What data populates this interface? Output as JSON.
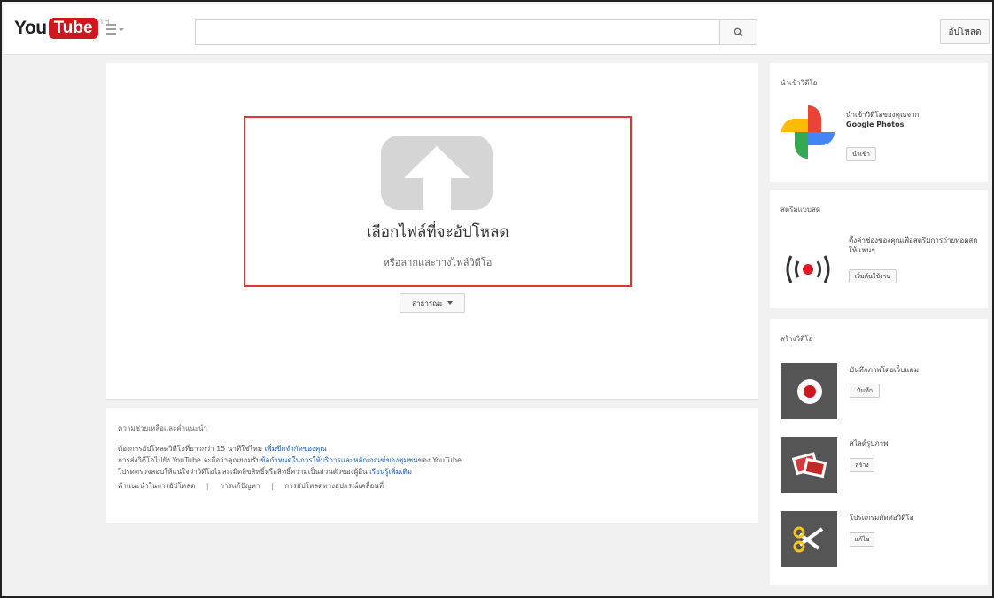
{
  "header": {
    "logo_you": "You",
    "logo_tube": "Tube",
    "logo_tm": "TH",
    "search_placeholder": "",
    "upload_label": "อัปโหลด"
  },
  "upload": {
    "title": "เลือกไฟล์ที่จะอัปโหลด",
    "subtitle": "หรือลากและวางไฟล์วิดีโอ",
    "privacy_selected": "สาธารณะ"
  },
  "help": {
    "title": "ความช่วยเหลือและคำแนะนำ",
    "line1": "ต้องการอัปโหลดวิดีโอที่ยาวกว่า 15 นาทีใช่ไหม ",
    "line1_link": "เพิ่มขีดจำกัดของคุณ",
    "line2_pre": "การส่งวิดีโอไปยัง YouTube จะถือว่าคุณยอมรับ",
    "line2_link": "ข้อกำหนดในการให้บริการและหลักเกณฑ์ของชุมชน",
    "line2_post": "ของ YouTube",
    "line3": "โปรดตรวจสอบให้แน่ใจว่าวิดีโอไม่ละเมิดลิขสิทธิ์หรือสิทธิ์ความเป็นส่วนตัวของผู้อื่น ",
    "line3_link": "เรียนรู้เพิ่มเติม",
    "links": [
      "คำแนะนำในการอัปโหลด",
      "การแก้ปัญหา",
      "การอัปโหลดทางอุปกรณ์เคลื่อนที่"
    ]
  },
  "sidebar": {
    "import": {
      "title": "นำเข้าวิดีโอ",
      "text": "นำเข้าวิดีโอของคุณจาก",
      "text_bold": "Google Photos",
      "button": "นำเข้า"
    },
    "live": {
      "title": "สตรีมแบบสด",
      "text": "ตั้งค่าช่องของคุณเพื่อสตรีมการถ่ายทอดสดให้แฟนๆ",
      "button": "เริ่มต้นใช้งาน"
    },
    "create": {
      "title": "สร้างวิดีโอ",
      "items": [
        {
          "label": "บันทึกภาพโดยเว็บแคม",
          "button": "บันทึก"
        },
        {
          "label": "สไลด์รูปภาพ",
          "button": "สร้าง"
        },
        {
          "label": "โปรแกรมตัดต่อวิดีโอ",
          "button": "แก้ไข"
        }
      ]
    }
  },
  "colors": {
    "brand_red": "#cc181e",
    "dropzone_border": "#d83a3a",
    "link_blue": "#1a5fb4"
  }
}
